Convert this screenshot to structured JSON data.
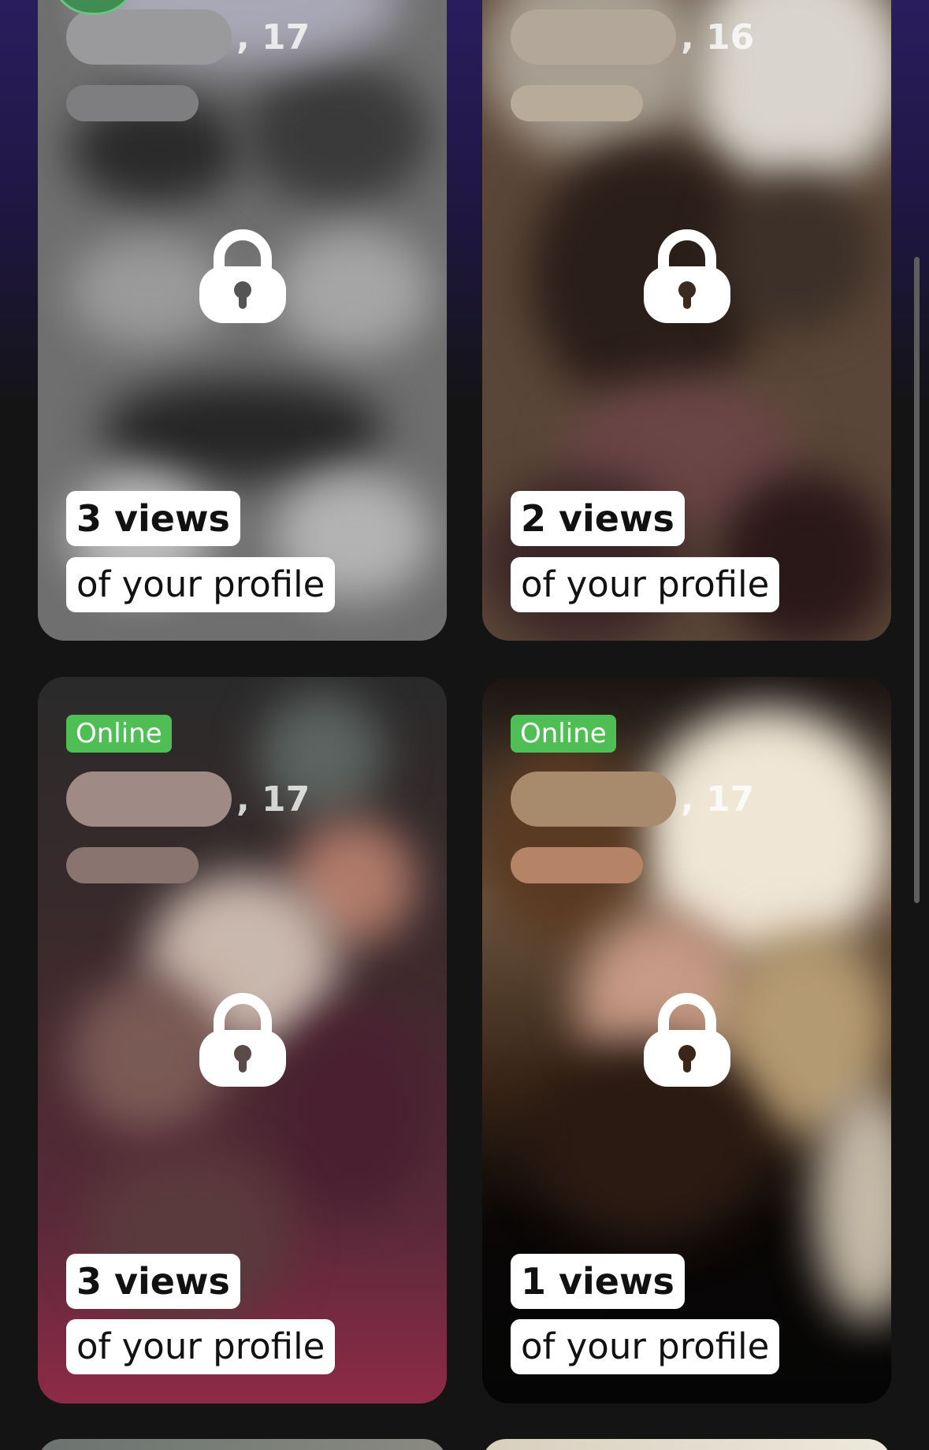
{
  "cards": [
    {
      "age": ", 17",
      "views": "3 views",
      "subtitle": "of your profile",
      "online": "",
      "lock_icon": "lock-icon"
    },
    {
      "age": ", 16",
      "views": "2 views",
      "subtitle": "of your profile",
      "online": "",
      "lock_icon": "lock-icon"
    },
    {
      "age": ", 17",
      "views": "3 views",
      "subtitle": "of your profile",
      "online": "Online",
      "lock_icon": "lock-icon"
    },
    {
      "age": ", 17",
      "views": "1 views",
      "subtitle": "of your profile",
      "online": "Online",
      "lock_icon": "lock-icon"
    }
  ],
  "colors": {
    "background": "#141414",
    "online_badge": "#4fbe55",
    "chip_bg": "#ffffff",
    "chip_text": "#111111",
    "top_accent": "#2a1d5e"
  }
}
